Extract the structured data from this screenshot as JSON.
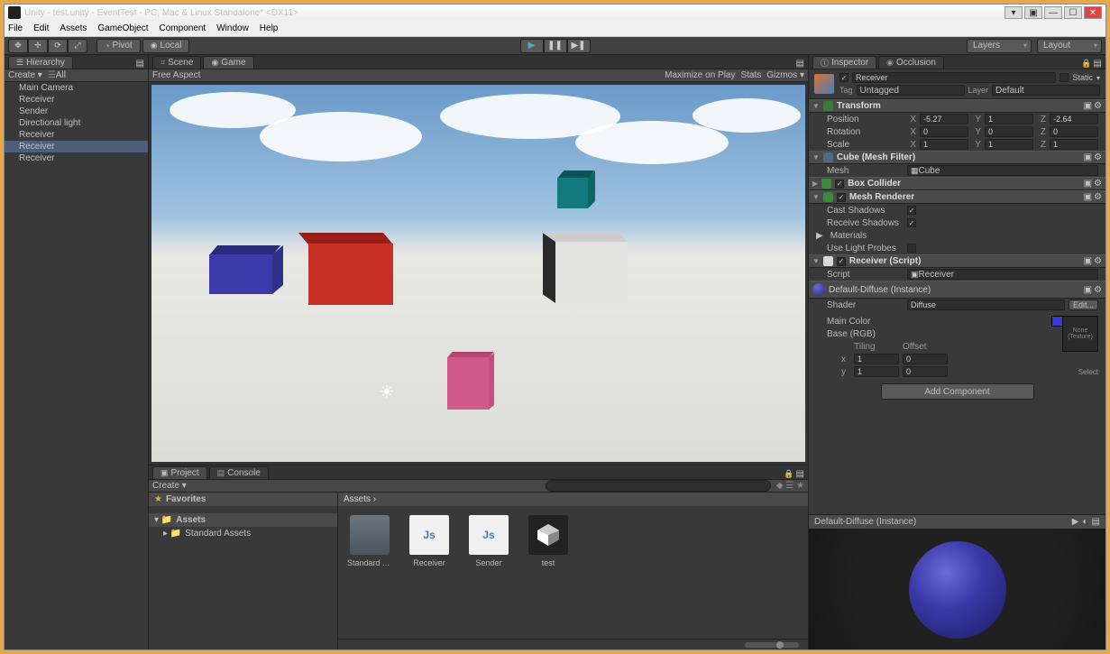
{
  "window": {
    "title": "Unity - test.unity - EventTest - PC, Mac & Linux Standalone* <DX11>"
  },
  "menu": [
    "File",
    "Edit",
    "Assets",
    "GameObject",
    "Component",
    "Window",
    "Help"
  ],
  "toolbar": {
    "pivot": "Pivot",
    "local": "Local",
    "layers": "Layers",
    "layout": "Layout"
  },
  "hierarchy": {
    "tab": "Hierarchy",
    "create": "Create",
    "all_filter": "All",
    "items": [
      "Main Camera",
      "Receiver",
      "Sender",
      "Directional light",
      "Receiver",
      "Receiver",
      "Receiver"
    ],
    "selected": 5
  },
  "scene_tabs": {
    "scene": "Scene",
    "game": "Game",
    "free_aspect": "Free Aspect",
    "maximize": "Maximize on Play",
    "stats": "Stats",
    "gizmos": "Gizmos"
  },
  "inspector": {
    "tab_inspector": "Inspector",
    "tab_occlusion": "Occlusion",
    "obj_name": "Receiver",
    "static": "Static",
    "tag_label": "Tag",
    "tag_value": "Untagged",
    "layer_label": "Layer",
    "layer_value": "Default",
    "transform": {
      "title": "Transform",
      "position": "Position",
      "px": "-5.27",
      "py": "1",
      "pz": "-2.64",
      "rotation": "Rotation",
      "rx": "0",
      "ry": "0",
      "rz": "0",
      "scale": "Scale",
      "sx": "1",
      "sy": "1",
      "sz": "1"
    },
    "cube_mf": {
      "title": "Cube (Mesh Filter)",
      "mesh_label": "Mesh",
      "mesh_value": "Cube"
    },
    "box_collider": {
      "title": "Box Collider"
    },
    "mesh_renderer": {
      "title": "Mesh Renderer",
      "cast": "Cast Shadows",
      "receive": "Receive Shadows",
      "materials": "Materials",
      "probes": "Use Light Probes"
    },
    "script": {
      "title": "Receiver (Script)",
      "label": "Script",
      "value": "Receiver"
    },
    "material": {
      "title": "Default-Diffuse (Instance)",
      "shader_label": "Shader",
      "shader_value": "Diffuse",
      "edit": "Edit...",
      "main_color": "Main Color",
      "base_rgb": "Base (RGB)",
      "tiling": "Tiling",
      "offset": "Offset",
      "x": "x",
      "y": "y",
      "tx": "1",
      "ty": "1",
      "ox": "0",
      "oy": "0",
      "none_tex": "None\n(Texture)",
      "select": "Select"
    },
    "add_component": "Add Component"
  },
  "preview": {
    "title": "Default-Diffuse (Instance)"
  },
  "project": {
    "tab_project": "Project",
    "tab_console": "Console",
    "create": "Create",
    "favorites": "Favorites",
    "assets": "Assets",
    "std_assets": "Standard Assets",
    "breadcrumb": "Assets ›",
    "items": [
      {
        "name": "Standard A...",
        "type": "folder"
      },
      {
        "name": "Receiver",
        "type": "js"
      },
      {
        "name": "Sender",
        "type": "js"
      },
      {
        "name": "test",
        "type": "unity"
      }
    ]
  }
}
